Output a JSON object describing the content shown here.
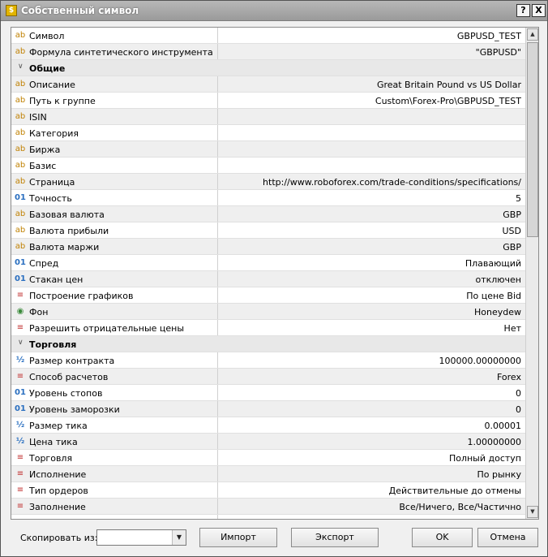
{
  "window": {
    "title": "Собственный символ",
    "help_label": "?",
    "close_label": "X"
  },
  "rows": [
    {
      "type": "prop",
      "icon": "ab",
      "name": "Символ",
      "value": "GBPUSD_TEST"
    },
    {
      "type": "prop",
      "icon": "ab",
      "name": "Формула синтетического инструмента",
      "value": "\"GBPUSD\""
    },
    {
      "type": "category",
      "name": "Общие"
    },
    {
      "type": "prop",
      "icon": "ab",
      "name": "Описание",
      "value": "Great Britain Pound vs US Dollar"
    },
    {
      "type": "prop",
      "icon": "ab",
      "name": "Путь к группе",
      "value": "Custom\\Forex-Pro\\GBPUSD_TEST"
    },
    {
      "type": "prop",
      "icon": "ab",
      "name": "ISIN",
      "value": ""
    },
    {
      "type": "prop",
      "icon": "ab",
      "name": "Категория",
      "value": ""
    },
    {
      "type": "prop",
      "icon": "ab",
      "name": "Биржа",
      "value": ""
    },
    {
      "type": "prop",
      "icon": "ab",
      "name": "Базис",
      "value": ""
    },
    {
      "type": "prop",
      "icon": "ab",
      "name": "Страница",
      "value": "http://www.roboforex.com/trade-conditions/specifications/"
    },
    {
      "type": "prop",
      "icon": "01",
      "name": "Точность",
      "value": "5"
    },
    {
      "type": "prop",
      "icon": "ab",
      "name": "Базовая валюта",
      "value": "GBP"
    },
    {
      "type": "prop",
      "icon": "ab",
      "name": "Валюта прибыли",
      "value": "USD"
    },
    {
      "type": "prop",
      "icon": "ab",
      "name": "Валюта маржи",
      "value": "GBP"
    },
    {
      "type": "prop",
      "icon": "01",
      "name": "Спред",
      "value": "Плавающий"
    },
    {
      "type": "prop",
      "icon": "01",
      "name": "Стакан цен",
      "value": "отключен"
    },
    {
      "type": "prop",
      "icon": "list",
      "name": "Построение графиков",
      "value": "По цене Bid"
    },
    {
      "type": "prop",
      "icon": "color",
      "name": "Фон",
      "value": "Honeydew"
    },
    {
      "type": "prop",
      "icon": "list",
      "name": "Разрешить отрицательные цены",
      "value": "Нет"
    },
    {
      "type": "category",
      "name": "Торговля"
    },
    {
      "type": "prop",
      "icon": "half",
      "name": "Размер контракта",
      "value": "100000.00000000"
    },
    {
      "type": "prop",
      "icon": "list",
      "name": "Способ расчетов",
      "value": "Forex"
    },
    {
      "type": "prop",
      "icon": "01",
      "name": "Уровень стопов",
      "value": "0"
    },
    {
      "type": "prop",
      "icon": "01",
      "name": "Уровень заморозки",
      "value": "0"
    },
    {
      "type": "prop",
      "icon": "half",
      "name": "Размер тика",
      "value": "0.00001"
    },
    {
      "type": "prop",
      "icon": "half",
      "name": "Цена тика",
      "value": "1.00000000"
    },
    {
      "type": "prop",
      "icon": "list",
      "name": "Торговля",
      "value": "Полный доступ"
    },
    {
      "type": "prop",
      "icon": "list",
      "name": "Исполнение",
      "value": "По рынку"
    },
    {
      "type": "prop",
      "icon": "list",
      "name": "Тип ордеров",
      "value": "Действительные до отмены"
    },
    {
      "type": "prop",
      "icon": "list",
      "name": "Заполнение",
      "value": "Все/Ничего, Все/Частично"
    },
    {
      "type": "prop",
      "icon": "list",
      "name": "",
      "value": ""
    }
  ],
  "icons": {
    "ab": "text-type-icon",
    "01": "integer-type-icon",
    "half": "fraction-type-icon",
    "list": "list-type-icon",
    "color": "color-type-icon"
  },
  "footer": {
    "copy_label": "Скопировать из:",
    "copy_value": "",
    "import_label": "Импорт",
    "export_label": "Экспорт",
    "ok_label": "OK",
    "cancel_label": "Отмена"
  }
}
